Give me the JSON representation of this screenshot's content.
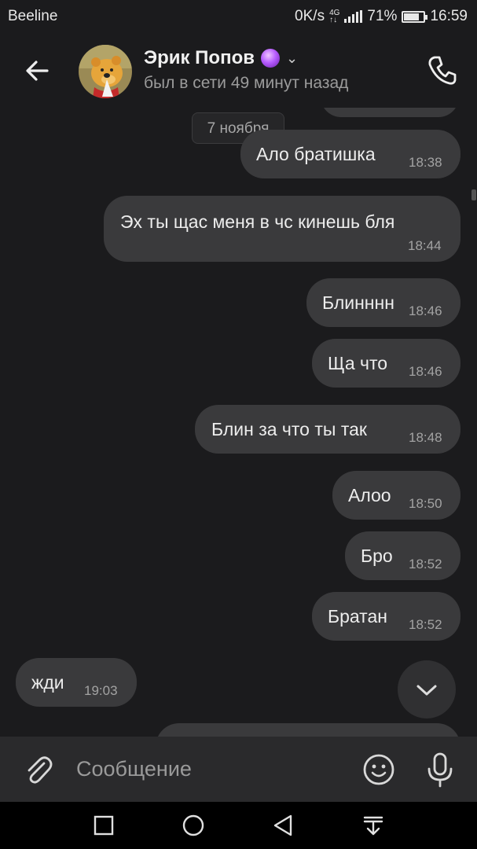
{
  "statusbar": {
    "carrier": "Beeline",
    "net_speed": "0K/s",
    "net_type_top": "4G",
    "net_type_bottom": "↑↓",
    "battery": "71%",
    "battery_level": 0.71,
    "time": "16:59"
  },
  "header": {
    "contact_name": "Эрик Попов",
    "last_seen": "был в сети 49 минут назад"
  },
  "chat": {
    "date_divider": "7 ноября",
    "messages": [
      {
        "text": "Ало братишка",
        "time": "18:38",
        "side": "out"
      },
      {
        "text": "Эх ты щас меня в чс кинешь бля",
        "time": "18:44",
        "side": "out"
      },
      {
        "text": "Блинннн",
        "time": "18:46",
        "side": "out"
      },
      {
        "text": "Ща что",
        "time": "18:46",
        "side": "out"
      },
      {
        "text": "Блин за что ты так",
        "time": "18:48",
        "side": "out"
      },
      {
        "text": "Алоо",
        "time": "18:50",
        "side": "out"
      },
      {
        "text": "Бро",
        "time": "18:52",
        "side": "out"
      },
      {
        "text": "Братан",
        "time": "18:52",
        "side": "out"
      },
      {
        "text": "жди",
        "time": "19:03",
        "side": "in"
      }
    ]
  },
  "composer": {
    "placeholder": "Сообщение"
  },
  "icons": {
    "back": "arrow-left-icon",
    "phone": "phone-icon",
    "attach": "paperclip-icon",
    "emoji": "smiley-icon",
    "mic": "microphone-icon",
    "scroll_down": "chevron-down-icon"
  },
  "colors": {
    "background": "#1b1b1d",
    "bubble": "#3a3a3c",
    "composer": "#2a2a2c"
  }
}
